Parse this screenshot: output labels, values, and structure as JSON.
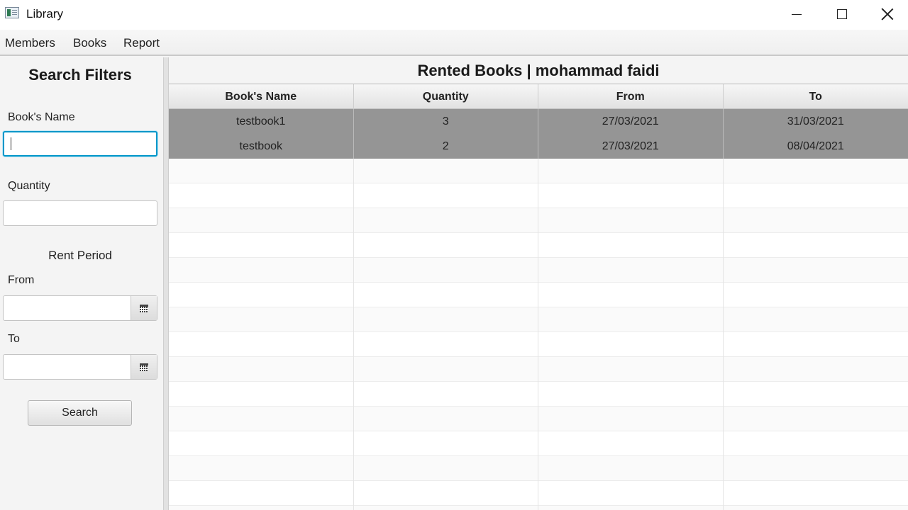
{
  "window": {
    "title": "Library"
  },
  "menu": {
    "items": [
      "Members",
      "Books",
      "Report"
    ]
  },
  "sidebar": {
    "title": "Search Filters",
    "book_name_label": "Book's Name",
    "book_name_value": "",
    "quantity_label": "Quantity",
    "quantity_value": "",
    "rent_period_label": "Rent Period",
    "from_label": "From",
    "from_value": "",
    "to_label": "To",
    "to_value": "",
    "search_label": "Search"
  },
  "main": {
    "title": "Rented Books | mohammad faidi",
    "columns": [
      "Book's Name",
      "Quantity",
      "From",
      "To"
    ],
    "rows": [
      [
        "testbook1",
        "3",
        "27/03/2021",
        "31/03/2021"
      ],
      [
        "testbook",
        "2",
        "27/03/2021",
        "08/04/2021"
      ]
    ],
    "selected_rows": [
      0,
      1
    ]
  },
  "icons": {
    "app": "library-app-icon",
    "minimize": "minimize-icon",
    "maximize": "maximize-icon",
    "close": "close-icon",
    "calendar": "calendar-icon"
  },
  "colors": {
    "focus_accent": "#0096c9",
    "selection": "#959595"
  }
}
